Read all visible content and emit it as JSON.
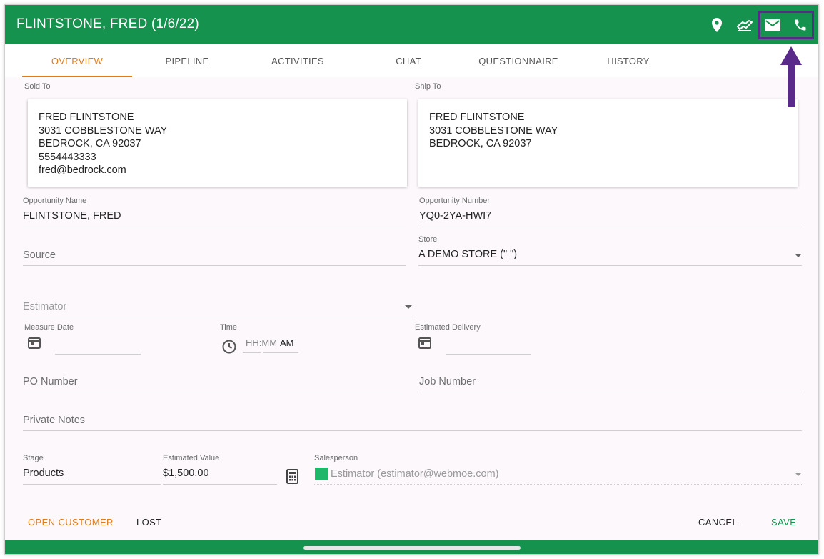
{
  "header": {
    "title": "FLINTSTONE, FRED (1/6/22)",
    "bar_color": "#14924e",
    "icons": [
      "map-pin-icon",
      "handshake-icon",
      "email-icon",
      "phone-icon"
    ],
    "highlight_color": "#5a2a8a"
  },
  "tabs": [
    {
      "label": "OVERVIEW",
      "active": true
    },
    {
      "label": "PIPELINE"
    },
    {
      "label": "ACTIVITIES"
    },
    {
      "label": "CHAT"
    },
    {
      "label": "QUESTIONNAIRE"
    },
    {
      "label": "HISTORY"
    }
  ],
  "sold_to": {
    "label": "Sold To",
    "lines": [
      "FRED FLINTSTONE",
      "3031 COBBLESTONE WAY",
      "BEDROCK, CA 92037",
      "5554443333",
      "fred@bedrock.com"
    ]
  },
  "ship_to": {
    "label": "Ship To",
    "lines": [
      "FRED FLINTSTONE",
      "3031 COBBLESTONE WAY",
      "BEDROCK, CA 92037"
    ]
  },
  "form": {
    "opportunity_name": {
      "label": "Opportunity Name",
      "value": "FLINTSTONE, FRED"
    },
    "opportunity_number": {
      "label": "Opportunity Number",
      "value": "YQ0-2YA-HWI7"
    },
    "source": {
      "placeholder": "Source"
    },
    "store": {
      "label": "Store",
      "value": "A DEMO STORE (\" \")"
    },
    "estimator": {
      "placeholder": "Estimator"
    },
    "measure_date": {
      "label": "Measure Date"
    },
    "time": {
      "label": "Time",
      "placeholder": "HH:MM",
      "ampm": "AM"
    },
    "estimated_delivery": {
      "label": "Estimated Delivery"
    },
    "po_number": {
      "placeholder": "PO Number"
    },
    "job_number": {
      "placeholder": "Job Number"
    },
    "private_notes": {
      "placeholder": "Private Notes"
    },
    "stage": {
      "label": "Stage",
      "value": "Products"
    },
    "estimated_value": {
      "label": "Estimated Value",
      "value": "$1,500.00"
    },
    "salesperson": {
      "label": "Salesperson",
      "value": "Estimator (estimator@webmoe.com)",
      "swatch_color": "#1fb86b"
    }
  },
  "actions": {
    "open_customer": "OPEN CUSTOMER",
    "lost": "LOST",
    "cancel": "CANCEL",
    "save": "SAVE"
  },
  "colors": {
    "accent_orange": "#e07b16",
    "save_green": "#14924e"
  }
}
